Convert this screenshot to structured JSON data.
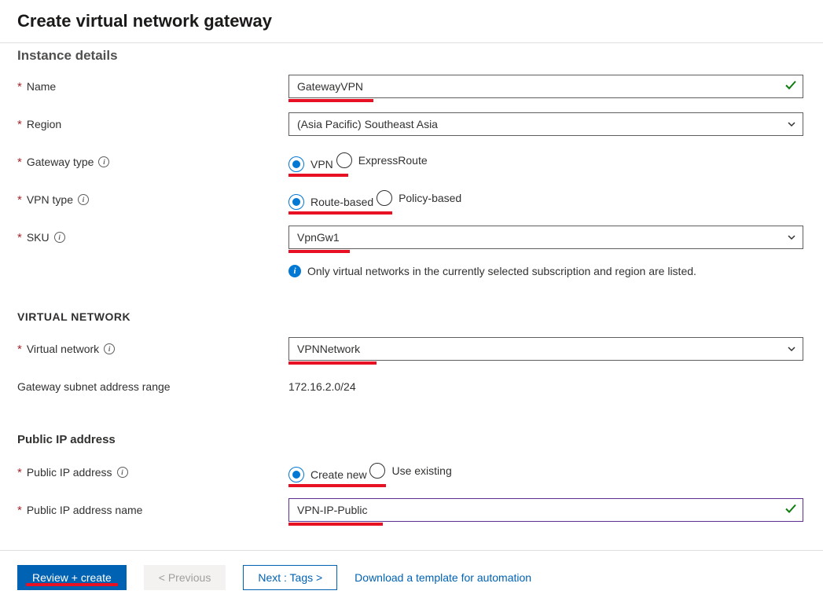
{
  "header": {
    "title": "Create virtual network gateway"
  },
  "instanceDetails": {
    "heading_cut": "Instance details",
    "name": {
      "label": "Name",
      "value": "GatewayVPN"
    },
    "region": {
      "label": "Region",
      "value": "(Asia Pacific) Southeast Asia"
    },
    "gatewayType": {
      "label": "Gateway type",
      "options": [
        "VPN",
        "ExpressRoute"
      ],
      "selected": "VPN"
    },
    "vpnType": {
      "label": "VPN type",
      "options": [
        "Route-based",
        "Policy-based"
      ],
      "selected": "Route-based"
    },
    "sku": {
      "label": "SKU",
      "value": "VpnGw1"
    },
    "hint": "Only virtual networks in the currently selected subscription and region are listed."
  },
  "virtualNetwork": {
    "heading": "VIRTUAL NETWORK",
    "vnet": {
      "label": "Virtual network",
      "value": "VPNNetwork"
    },
    "subnet": {
      "label": "Gateway subnet address range",
      "value": "172.16.2.0/24"
    }
  },
  "publicIp": {
    "heading": "Public IP address",
    "mode": {
      "label": "Public IP address",
      "options": [
        "Create new",
        "Use existing"
      ],
      "selected": "Create new"
    },
    "name": {
      "label": "Public IP address name",
      "value": "VPN-IP-Public"
    }
  },
  "footer": {
    "review": "Review + create",
    "previous": "< Previous",
    "next": "Next : Tags >",
    "download": "Download a template for automation"
  }
}
